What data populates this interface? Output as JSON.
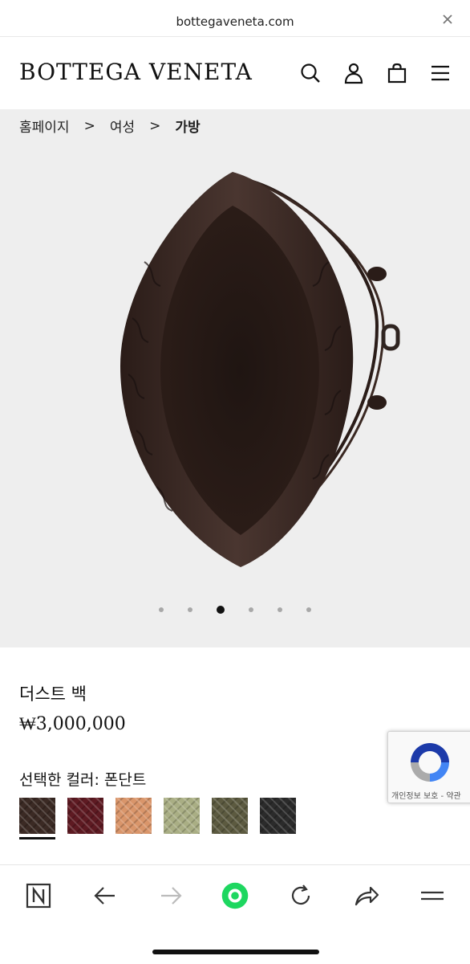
{
  "browser": {
    "url": "bottegaveneta.com"
  },
  "header": {
    "logo": "BOTTEGA VENETA",
    "icons": [
      "search-icon",
      "account-icon",
      "shopping-bag-icon",
      "menu-icon"
    ]
  },
  "breadcrumb": {
    "home": "홈페이지",
    "women": "여성",
    "current": "가방",
    "separator": ">"
  },
  "gallery": {
    "image_count": 6,
    "active_index": 2
  },
  "product": {
    "name": "더스트 백",
    "price": "₩3,000,000",
    "color_label": "선택한 컬러: 폰단트",
    "swatches": [
      {
        "color": "#3b2a24",
        "selected": true
      },
      {
        "color": "#5e1a22",
        "selected": false
      },
      {
        "color": "#d9956a",
        "selected": false
      },
      {
        "color": "#a9ae84",
        "selected": false
      },
      {
        "color": "#5c5a40",
        "selected": false
      },
      {
        "color": "#2b2b2b",
        "selected": false
      }
    ]
  },
  "recaptcha": {
    "text": "개인정보 보호 - 약관"
  },
  "toolbar": {
    "icons": [
      "naver-n-icon",
      "back-arrow-icon",
      "forward-arrow-icon",
      "green-home-icon",
      "refresh-icon",
      "share-icon",
      "menu-lines-icon"
    ],
    "accent": "#1ed760"
  }
}
